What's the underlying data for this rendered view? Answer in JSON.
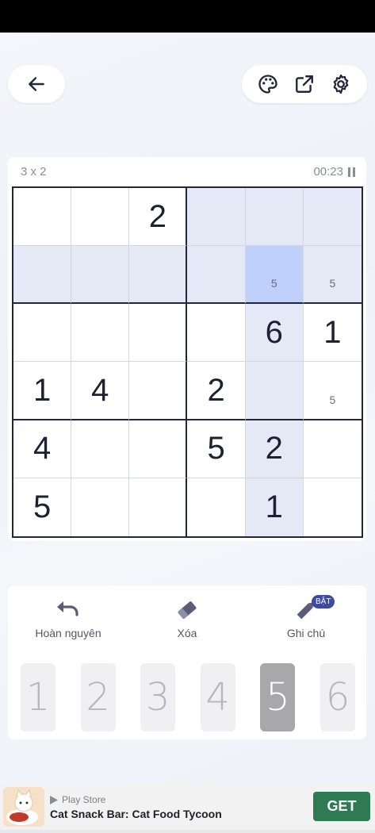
{
  "board": {
    "size_label": "3 x 2",
    "timer": "00:23",
    "cells": [
      [
        "",
        "",
        "2",
        "",
        "",
        ""
      ],
      [
        "",
        "",
        "",
        "",
        "",
        ""
      ],
      [
        "",
        "",
        "",
        "",
        "6",
        "1"
      ],
      [
        "1",
        "4",
        "",
        "2",
        "",
        ""
      ],
      [
        "4",
        "",
        "",
        "5",
        "2",
        ""
      ],
      [
        "5",
        "",
        "",
        "",
        "1",
        ""
      ]
    ],
    "notes": [
      {
        "row": 1,
        "col": 4,
        "text": "5"
      },
      {
        "row": 1,
        "col": 5,
        "text": "5"
      },
      {
        "row": 3,
        "col": 5,
        "text": "5"
      }
    ],
    "selected": {
      "row": 1,
      "col": 4
    },
    "colors": {
      "highlight": "#e5e8f5",
      "selected": "#bfd0fb",
      "thick_line": "#23253a"
    }
  },
  "header": {
    "back_icon": "arrow-left-icon",
    "tools": [
      "palette-icon",
      "share-external-icon",
      "gear-icon"
    ]
  },
  "controls": {
    "undo_label": "Hoàn nguyên",
    "erase_label": "Xóa",
    "notes_label": "Ghi chú",
    "notes_badge": "BẬT",
    "numbers": [
      "1",
      "2",
      "3",
      "4",
      "5",
      "6"
    ],
    "active_number": "5"
  },
  "ad": {
    "store": "Play Store",
    "title": "Cat Snack Bar: Cat Food Tycoon",
    "button": "GET",
    "button_color": "#2e7a52"
  }
}
